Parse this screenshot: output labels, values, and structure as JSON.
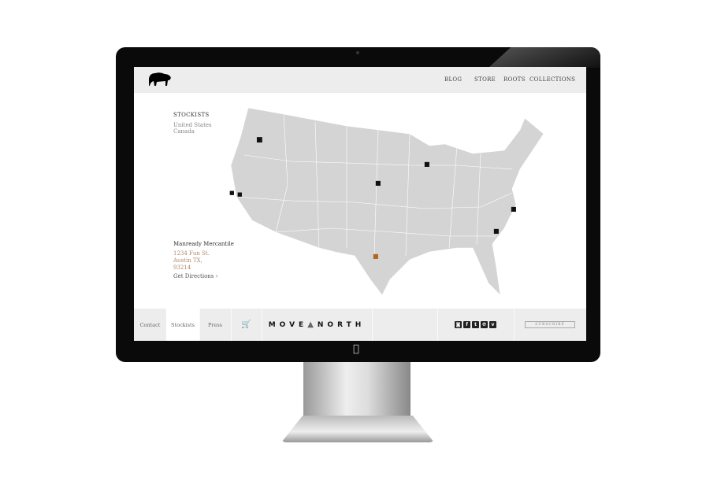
{
  "header": {
    "logo": "bison-logo",
    "nav": [
      "BLOG",
      "STORE",
      "ROOTS",
      "COLLECTIONS"
    ]
  },
  "sidebar": {
    "title": "STOCKISTS",
    "countries": [
      "United States",
      "Canada"
    ]
  },
  "store": {
    "name": "Manready Mercantile",
    "address": [
      "1234 Fun St.",
      "Austin TX,",
      "93214"
    ],
    "directions": "Get Directions ›"
  },
  "footer": {
    "tabs": [
      "Contact",
      "Stockists",
      "Press"
    ],
    "cart_icon": "cart-icon",
    "brand": "MOVE",
    "brand2": "NORTH",
    "social": [
      "instagram",
      "facebook",
      "tumblr",
      "pinterest",
      "vimeo"
    ],
    "social_glyphs": [
      "◙",
      "f",
      "t",
      "℗",
      "v"
    ],
    "subscribe": "SUBSCRIBE"
  },
  "colors": {
    "map": "#d4d4d4",
    "pin": "#111111",
    "active_pin": "#b5651d",
    "address": "#b08a6a"
  }
}
